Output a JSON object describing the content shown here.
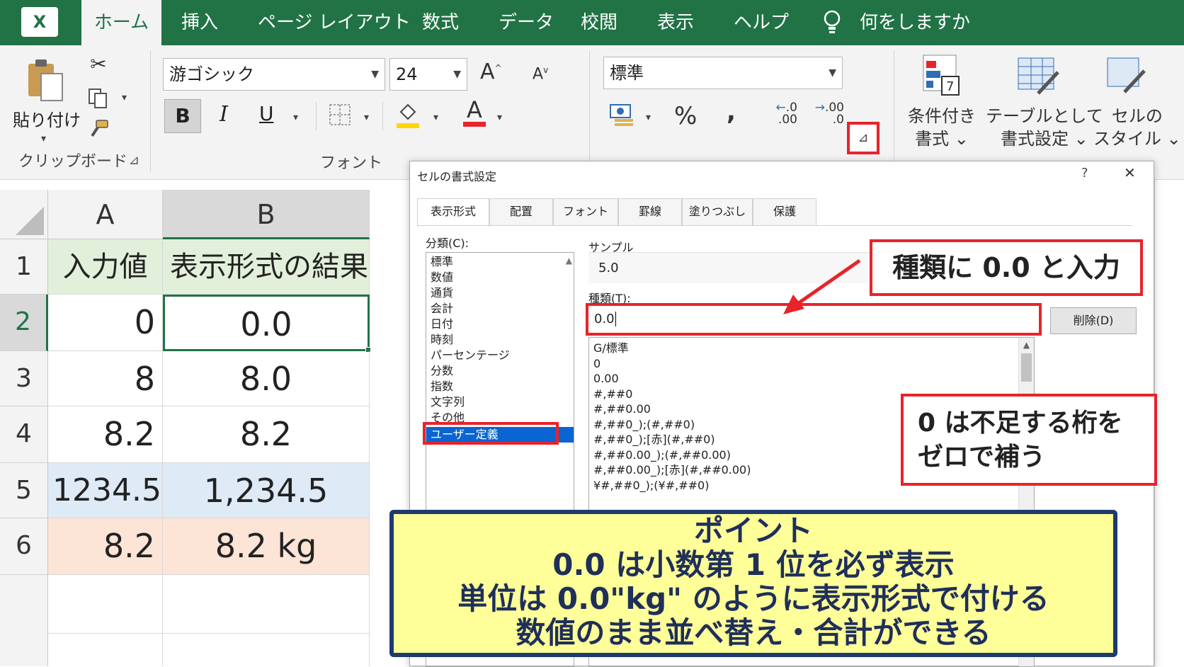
{
  "tabs": [
    "ホーム",
    "挿入",
    "ページ レイアウト",
    "数式",
    "データ",
    "校閲",
    "表示",
    "ヘルプ"
  ],
  "tell_me": "何をしますか",
  "clipboard": {
    "paste_label": "貼り付け",
    "group_label": "クリップボード"
  },
  "font": {
    "name": "游ゴシック",
    "size": "24",
    "group_label": "フォント",
    "bold": "B",
    "italic": "I",
    "underline": "U",
    "font_color_letter": "A",
    "grow": "A",
    "shrink": "A"
  },
  "number": {
    "format": "標準",
    "percent": "%",
    "comma": ",",
    "inc_decimal": ".0\n.00",
    "dec_decimal": ".00\n.0"
  },
  "styles": {
    "conditional": "条件付き\n書式 ⌄",
    "table": "テーブルとして\n書式設定 ⌄",
    "cell": "セルの\nスタイル ⌄"
  },
  "sheet": {
    "columns": [
      "A",
      "B"
    ],
    "rows": [
      {
        "num": "1",
        "a": "入力値",
        "b": "表示形式の結果"
      },
      {
        "num": "2",
        "a": "0",
        "b": "0.0"
      },
      {
        "num": "3",
        "a": "8",
        "b": "8.0"
      },
      {
        "num": "4",
        "a": "8.2",
        "b": "8.2"
      },
      {
        "num": "5",
        "a": "1234.5",
        "b": "1,234.5"
      },
      {
        "num": "6",
        "a": "8.2",
        "b": "8.2 kg"
      }
    ]
  },
  "dialog": {
    "title": "セルの書式設定",
    "help": "?",
    "close": "✕",
    "tabs": [
      "表示形式",
      "配置",
      "フォント",
      "罫線",
      "塗りつぶし",
      "保護"
    ],
    "category_label": "分類(C):",
    "categories": [
      "標準",
      "数値",
      "通貨",
      "会計",
      "日付",
      "時刻",
      "パーセンテージ",
      "分数",
      "指数",
      "文字列",
      "その他",
      "ユーザー定義"
    ],
    "sample_label": "サンプル",
    "sample_value": "5.0",
    "type_label": "種類(T):",
    "type_value": "0.0",
    "delete_button": "削除(D)",
    "type_list": [
      "G/標準",
      "0",
      "0.00",
      "#,##0",
      "#,##0.00",
      "#,##0_);(#,##0)",
      "#,##0_);[赤](#,##0)",
      "#,##0.00_);(#,##0.00)",
      "#,##0.00_);[赤](#,##0.00)",
      "¥#,##0_);(¥#,##0)"
    ]
  },
  "callouts": {
    "type_input": "種類に 0.0 と入力",
    "zero_pad_1": "0 は不足する桁を",
    "zero_pad_2": "ゼロで補う"
  },
  "point": {
    "heading": "ポイント",
    "line1": "0.0 は小数第 1 位を必ず表示",
    "line2": "単位は 0.0\"kg\" のように表示形式で付ける",
    "line3": "数値のまま並べ替え・合計ができる"
  },
  "colors": {
    "excel_green": "#217346",
    "callout_red": "#e8232a",
    "point_bg": "#ffff99",
    "point_border": "#1f3a6e",
    "selection_blue": "#0a64d2"
  }
}
